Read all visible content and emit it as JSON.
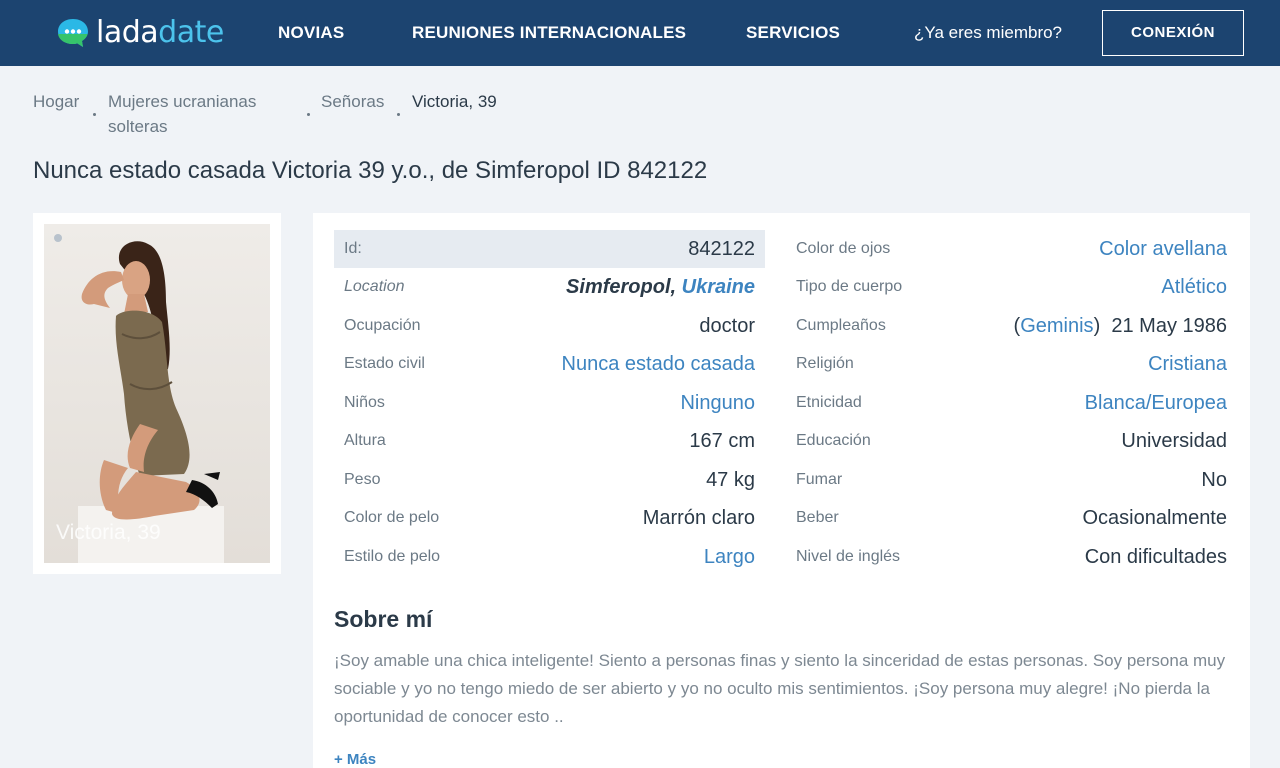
{
  "brand": {
    "part1": "lada",
    "part2": "date",
    "primary": "#1c4470",
    "accent": "#4cc3ec",
    "link": "#3d84c0"
  },
  "nav": {
    "items": [
      "NOVIAS",
      "REUNIONES INTERNACIONALES",
      "SERVICIOS"
    ],
    "member_prompt": "¿Ya eres miembro?",
    "login_label": "CONEXIÓN"
  },
  "breadcrumb": [
    "Hogar",
    "Mujeres ucranianas",
    "solteras",
    "Señoras",
    "Victoria, 39"
  ],
  "title": "Nunca estado casada Victoria 39 y.o., de Simferopol ID 842122",
  "photo": {
    "caption": "Victoria, 39",
    "icon": "photo-indicator-dot"
  },
  "profile": {
    "left": [
      {
        "label": "Id:",
        "value": "842122"
      },
      {
        "label": "Location",
        "city": "Simferopol,",
        "country": "Ukraine"
      },
      {
        "label": "Ocupación",
        "value": "doctor"
      },
      {
        "label": "Estado civil",
        "value": "Nunca estado casada"
      },
      {
        "label": "Niños",
        "value": "Ninguno"
      },
      {
        "label": "Altura",
        "value": "167 cm"
      },
      {
        "label": "Peso",
        "value": "47 kg"
      },
      {
        "label": "Color de pelo",
        "value": "Marrón claro"
      },
      {
        "label": "Estilo de pelo",
        "value": "Largo"
      }
    ],
    "right": [
      {
        "label": "Color de ojos",
        "value": "Color avellana"
      },
      {
        "label": "Tipo de cuerpo",
        "value": "Atlético"
      },
      {
        "label": "Cumpleaños",
        "paren_open": "(",
        "zodiac": "Geminis",
        "paren_close": ")",
        "date": "21 May 1986"
      },
      {
        "label": "Religión",
        "value": "Cristiana"
      },
      {
        "label": "Etnicidad",
        "value": "Blanca/Europea"
      },
      {
        "label": "Educación",
        "value": "Universidad"
      },
      {
        "label": "Fumar",
        "value": "No"
      },
      {
        "label": "Beber",
        "value": "Ocasionalmente"
      },
      {
        "label": "Nivel de inglés",
        "value": "Con dificultades"
      }
    ]
  },
  "about": {
    "title": "Sobre mí",
    "text": "¡Soy amable una chica inteligente! Siento a personas finas y siento la sinceridad de estas personas. Soy persona muy sociable y yo no tengo miedo de ser abierto y yo no oculto mis sentimientos. ¡Soy persona muy alegre! ¡No pierda la oportunidad de conocer esto ..",
    "more_label": "+ Más"
  }
}
